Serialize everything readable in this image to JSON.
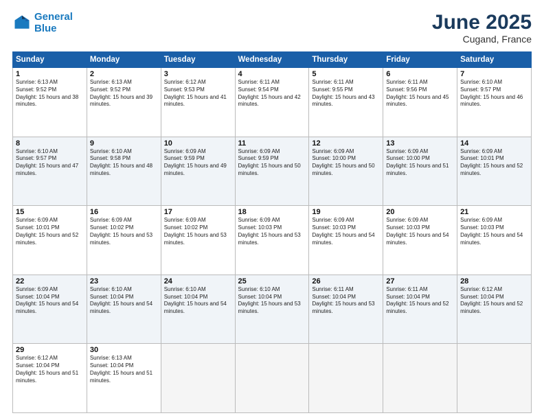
{
  "header": {
    "logo_line1": "General",
    "logo_line2": "Blue",
    "month": "June 2025",
    "location": "Cugand, France"
  },
  "weekdays": [
    "Sunday",
    "Monday",
    "Tuesday",
    "Wednesday",
    "Thursday",
    "Friday",
    "Saturday"
  ],
  "weeks": [
    [
      {
        "day": "1",
        "sunrise": "Sunrise: 6:13 AM",
        "sunset": "Sunset: 9:52 PM",
        "daylight": "Daylight: 15 hours and 38 minutes."
      },
      {
        "day": "2",
        "sunrise": "Sunrise: 6:13 AM",
        "sunset": "Sunset: 9:52 PM",
        "daylight": "Daylight: 15 hours and 39 minutes."
      },
      {
        "day": "3",
        "sunrise": "Sunrise: 6:12 AM",
        "sunset": "Sunset: 9:53 PM",
        "daylight": "Daylight: 15 hours and 41 minutes."
      },
      {
        "day": "4",
        "sunrise": "Sunrise: 6:11 AM",
        "sunset": "Sunset: 9:54 PM",
        "daylight": "Daylight: 15 hours and 42 minutes."
      },
      {
        "day": "5",
        "sunrise": "Sunrise: 6:11 AM",
        "sunset": "Sunset: 9:55 PM",
        "daylight": "Daylight: 15 hours and 43 minutes."
      },
      {
        "day": "6",
        "sunrise": "Sunrise: 6:11 AM",
        "sunset": "Sunset: 9:56 PM",
        "daylight": "Daylight: 15 hours and 45 minutes."
      },
      {
        "day": "7",
        "sunrise": "Sunrise: 6:10 AM",
        "sunset": "Sunset: 9:57 PM",
        "daylight": "Daylight: 15 hours and 46 minutes."
      }
    ],
    [
      {
        "day": "8",
        "sunrise": "Sunrise: 6:10 AM",
        "sunset": "Sunset: 9:57 PM",
        "daylight": "Daylight: 15 hours and 47 minutes."
      },
      {
        "day": "9",
        "sunrise": "Sunrise: 6:10 AM",
        "sunset": "Sunset: 9:58 PM",
        "daylight": "Daylight: 15 hours and 48 minutes."
      },
      {
        "day": "10",
        "sunrise": "Sunrise: 6:09 AM",
        "sunset": "Sunset: 9:59 PM",
        "daylight": "Daylight: 15 hours and 49 minutes."
      },
      {
        "day": "11",
        "sunrise": "Sunrise: 6:09 AM",
        "sunset": "Sunset: 9:59 PM",
        "daylight": "Daylight: 15 hours and 50 minutes."
      },
      {
        "day": "12",
        "sunrise": "Sunrise: 6:09 AM",
        "sunset": "Sunset: 10:00 PM",
        "daylight": "Daylight: 15 hours and 50 minutes."
      },
      {
        "day": "13",
        "sunrise": "Sunrise: 6:09 AM",
        "sunset": "Sunset: 10:00 PM",
        "daylight": "Daylight: 15 hours and 51 minutes."
      },
      {
        "day": "14",
        "sunrise": "Sunrise: 6:09 AM",
        "sunset": "Sunset: 10:01 PM",
        "daylight": "Daylight: 15 hours and 52 minutes."
      }
    ],
    [
      {
        "day": "15",
        "sunrise": "Sunrise: 6:09 AM",
        "sunset": "Sunset: 10:01 PM",
        "daylight": "Daylight: 15 hours and 52 minutes."
      },
      {
        "day": "16",
        "sunrise": "Sunrise: 6:09 AM",
        "sunset": "Sunset: 10:02 PM",
        "daylight": "Daylight: 15 hours and 53 minutes."
      },
      {
        "day": "17",
        "sunrise": "Sunrise: 6:09 AM",
        "sunset": "Sunset: 10:02 PM",
        "daylight": "Daylight: 15 hours and 53 minutes."
      },
      {
        "day": "18",
        "sunrise": "Sunrise: 6:09 AM",
        "sunset": "Sunset: 10:03 PM",
        "daylight": "Daylight: 15 hours and 53 minutes."
      },
      {
        "day": "19",
        "sunrise": "Sunrise: 6:09 AM",
        "sunset": "Sunset: 10:03 PM",
        "daylight": "Daylight: 15 hours and 54 minutes."
      },
      {
        "day": "20",
        "sunrise": "Sunrise: 6:09 AM",
        "sunset": "Sunset: 10:03 PM",
        "daylight": "Daylight: 15 hours and 54 minutes."
      },
      {
        "day": "21",
        "sunrise": "Sunrise: 6:09 AM",
        "sunset": "Sunset: 10:03 PM",
        "daylight": "Daylight: 15 hours and 54 minutes."
      }
    ],
    [
      {
        "day": "22",
        "sunrise": "Sunrise: 6:09 AM",
        "sunset": "Sunset: 10:04 PM",
        "daylight": "Daylight: 15 hours and 54 minutes."
      },
      {
        "day": "23",
        "sunrise": "Sunrise: 6:10 AM",
        "sunset": "Sunset: 10:04 PM",
        "daylight": "Daylight: 15 hours and 54 minutes."
      },
      {
        "day": "24",
        "sunrise": "Sunrise: 6:10 AM",
        "sunset": "Sunset: 10:04 PM",
        "daylight": "Daylight: 15 hours and 54 minutes."
      },
      {
        "day": "25",
        "sunrise": "Sunrise: 6:10 AM",
        "sunset": "Sunset: 10:04 PM",
        "daylight": "Daylight: 15 hours and 53 minutes."
      },
      {
        "day": "26",
        "sunrise": "Sunrise: 6:11 AM",
        "sunset": "Sunset: 10:04 PM",
        "daylight": "Daylight: 15 hours and 53 minutes."
      },
      {
        "day": "27",
        "sunrise": "Sunrise: 6:11 AM",
        "sunset": "Sunset: 10:04 PM",
        "daylight": "Daylight: 15 hours and 52 minutes."
      },
      {
        "day": "28",
        "sunrise": "Sunrise: 6:12 AM",
        "sunset": "Sunset: 10:04 PM",
        "daylight": "Daylight: 15 hours and 52 minutes."
      }
    ],
    [
      {
        "day": "29",
        "sunrise": "Sunrise: 6:12 AM",
        "sunset": "Sunset: 10:04 PM",
        "daylight": "Daylight: 15 hours and 51 minutes."
      },
      {
        "day": "30",
        "sunrise": "Sunrise: 6:13 AM",
        "sunset": "Sunset: 10:04 PM",
        "daylight": "Daylight: 15 hours and 51 minutes."
      },
      null,
      null,
      null,
      null,
      null
    ]
  ]
}
